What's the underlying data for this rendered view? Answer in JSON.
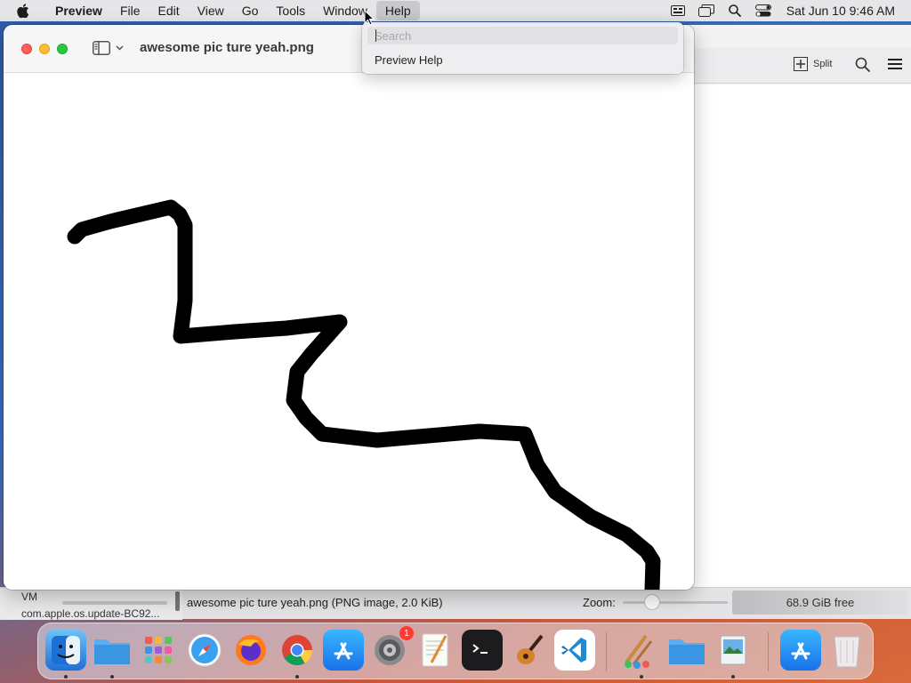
{
  "menubar": {
    "app_name": "Preview",
    "items": [
      "File",
      "Edit",
      "View",
      "Go",
      "Tools",
      "Window",
      "Help"
    ],
    "clock": "Sat Jun 10  9:46 AM"
  },
  "window": {
    "title": "awesome pic ture yeah.png"
  },
  "help_menu": {
    "search_placeholder": "Search",
    "items": [
      "Preview Help"
    ]
  },
  "background_window": {
    "split_label": "Split"
  },
  "statusbar": {
    "vm_label": "VM",
    "update_label": "com.apple.os.update-BC92...",
    "file_info": "awesome pic ture yeah.png (PNG image, 2.0 KiB)",
    "zoom_label": "Zoom:",
    "zoom_level": 0.25,
    "disk_free": "68.9 GiB free"
  },
  "dock": {
    "apps": [
      "finder-icon",
      "folder-icon",
      "launchpad-icon",
      "safari-icon",
      "firefox-icon",
      "chrome-icon",
      "app-store-icon",
      "system-preferences-icon",
      "textedit-icon",
      "terminal-icon",
      "garageband-icon",
      "vscode-icon",
      "brushes-icon",
      "downloads-folder-icon",
      "preview-icon",
      "app-store-2-icon",
      "trash-icon"
    ],
    "notification_badge": "1"
  }
}
